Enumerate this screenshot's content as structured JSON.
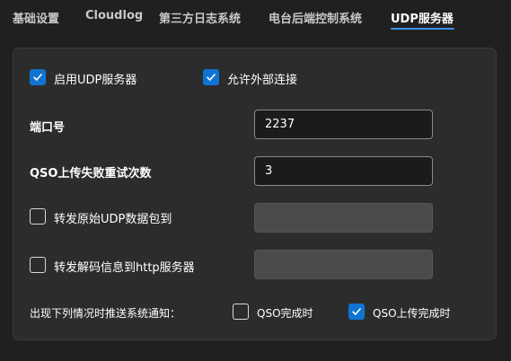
{
  "tabs": [
    {
      "label": "基础设置"
    },
    {
      "label": "Cloudlog"
    },
    {
      "label": "第三方日志系统"
    },
    {
      "label": "电台后端控制系统"
    },
    {
      "label": "UDP服务器"
    }
  ],
  "udp": {
    "enable_label": "启用UDP服务器",
    "enable_checked": true,
    "allow_external_label": "允许外部连接",
    "allow_external_checked": true,
    "port_label": "端口号",
    "port_value": "2237",
    "retry_label": "QSO上传失败重试次数",
    "retry_value": "3",
    "forward_raw_label": "转发原始UDP数据包到",
    "forward_raw_checked": false,
    "forward_raw_value": "",
    "forward_http_label": "转发解码信息到http服务器",
    "forward_http_checked": false,
    "forward_http_value": "",
    "notify_label": "出现下列情况时推送系统通知：",
    "notify_qso_done_label": "QSO完成时",
    "notify_qso_done_checked": false,
    "notify_upload_done_label": "QSO上传完成时",
    "notify_upload_done_checked": true
  },
  "colors": {
    "accent": "#0f74d1",
    "tab_underline": "#3b8eea",
    "background": "#202020",
    "panel": "#2c2c2c"
  }
}
